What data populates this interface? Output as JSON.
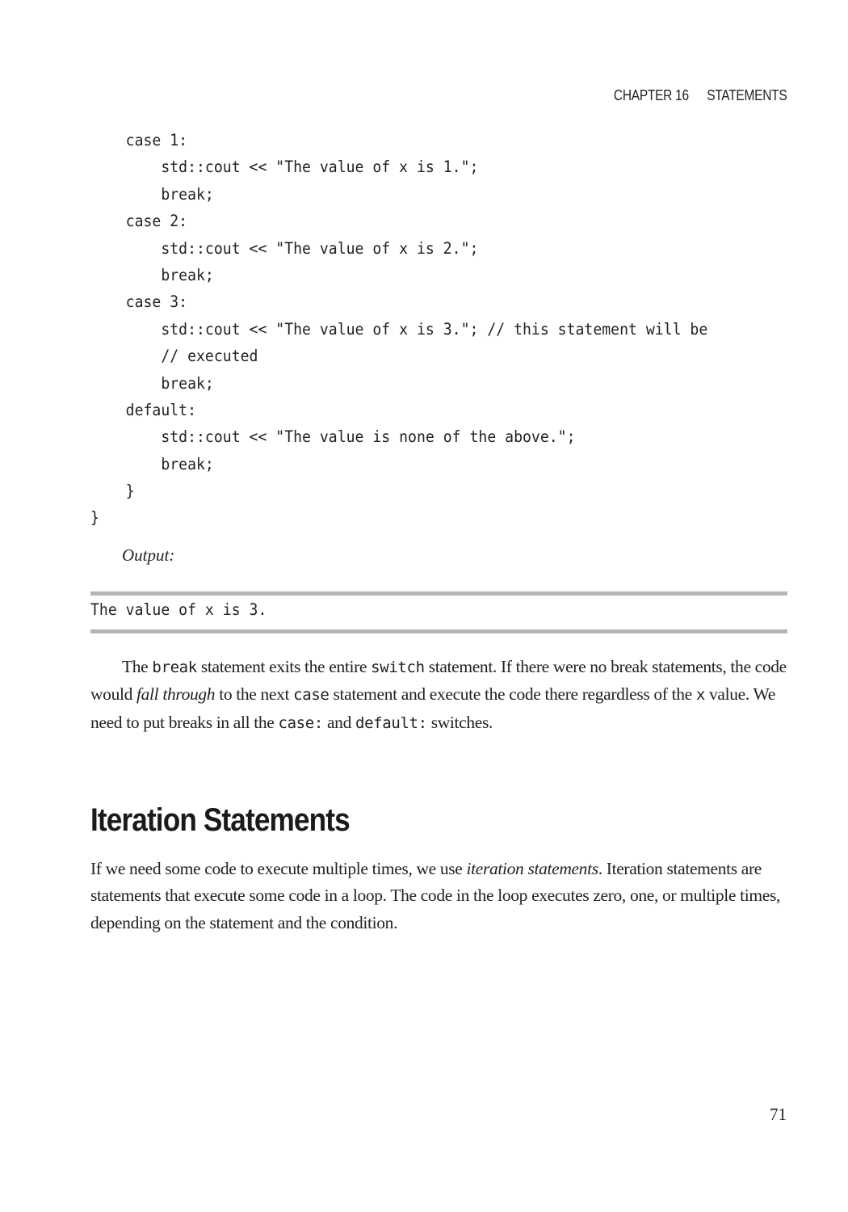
{
  "running_head": {
    "chapter": "CHAPTER 16",
    "title": "STATEMENTS"
  },
  "code_listing": {
    "lines": [
      "    case 1:",
      "        std::cout << \"The value of x is 1.\";",
      "        break;",
      "    case 2:",
      "        std::cout << \"The value of x is 2.\";",
      "        break;",
      "    case 3:",
      "        std::cout << \"The value of x is 3.\"; // this statement will be",
      "        // executed",
      "        break;",
      "    default:",
      "        std::cout << \"The value is none of the above.\";",
      "        break;",
      "    }",
      "}"
    ]
  },
  "output": {
    "label": "Output:",
    "text": "The value of x is 3."
  },
  "paragraph_1": {
    "s1": "The ",
    "c1": "break",
    "s2": " statement exits the entire ",
    "c2": "switch",
    "s3": " statement. If there were no break statements, the code would ",
    "e1": "fall through",
    "s4": " to the next ",
    "c3": "case",
    "s5": " statement and execute the code there regardless of the ",
    "c4": "x",
    "s6": " value. We need to put breaks in all the ",
    "c5": "case:",
    "s7": " and ",
    "c6": "default:",
    "s8": " switches."
  },
  "section": {
    "heading": "Iteration Statements"
  },
  "paragraph_2": {
    "s1": "If we need some code to execute multiple times, we use ",
    "e1": "iteration statements",
    "s2": ". Iteration statements are statements that execute some code in a loop. The code in the loop executes zero, one, or multiple times, depending on the statement and the condition."
  },
  "page_number": "71"
}
